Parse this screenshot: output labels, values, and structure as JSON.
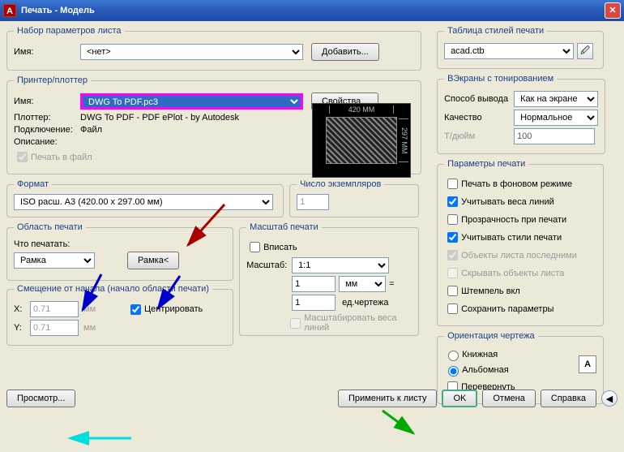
{
  "window": {
    "title": "Печать - Модель"
  },
  "pageset": {
    "legend": "Набор параметров листа",
    "name_lbl": "Имя:",
    "name_val": "<нет>",
    "add_btn": "Добавить..."
  },
  "printer": {
    "legend": "Принтер/плоттер",
    "name_lbl": "Имя:",
    "name_val": "DWG To PDF.pc3",
    "props_btn": "Свойства...",
    "plotter_lbl": "Плоттер:",
    "plotter_val": "DWG To PDF - PDF ePlot - by Autodesk",
    "conn_lbl": "Подключение:",
    "conn_val": "Файл",
    "desc_lbl": "Описание:",
    "tofile": "Печать в файл",
    "dim_w": "420 MM",
    "dim_h": "297 MM"
  },
  "format": {
    "legend": "Формат",
    "val": "ISO расш. A3 (420.00 x 297.00 мм)"
  },
  "copies": {
    "legend": "Число экземпляров",
    "val": "1"
  },
  "area": {
    "legend": "Область печати",
    "what_lbl": "Что печатать:",
    "what_val": "Рамка",
    "window_btn": "Рамка<"
  },
  "scale": {
    "legend": "Масштаб печати",
    "fit": "Вписать",
    "scale_lbl": "Масштаб:",
    "scale_val": "1:1",
    "val1": "1",
    "unit": "мм",
    "eq": "=",
    "val2": "1",
    "unit2": "ед.чертежа",
    "scale_lw": "Масштабировать веса линий"
  },
  "offset": {
    "legend": "Смещение от начала (начало области печати)",
    "x_lbl": "X:",
    "x_val": "0.71",
    "y_lbl": "Y:",
    "y_val": "0.71",
    "mm": "мм",
    "center": "Центрировать"
  },
  "styletable": {
    "legend": "Таблица стилей печати",
    "val": "acad.ctb"
  },
  "shade": {
    "legend": "ВЭкраны с тонированием",
    "mode_lbl": "Способ вывода",
    "mode_val": "Как на экране",
    "quality_lbl": "Качество",
    "quality_val": "Нормальное",
    "dpi_lbl": "Т/дюйм",
    "dpi_val": "100"
  },
  "params": {
    "legend": "Параметры печати",
    "bg": "Печать в фоновом режиме",
    "lw": "Учитывать веса линий",
    "trans": "Прозрачность при печати",
    "styles": "Учитывать стили печати",
    "last": "Объекты листа последними",
    "hide": "Скрывать объекты листа",
    "stamp": "Штемпель вкл",
    "save": "Сохранить параметры"
  },
  "orient": {
    "legend": "Ориентация чертежа",
    "portrait": "Книжная",
    "landscape": "Альбомная",
    "upside": "Перевернуть"
  },
  "footer": {
    "preview": "Просмотр...",
    "apply": "Применить к листу",
    "ok": "OK",
    "cancel": "Отмена",
    "help": "Справка"
  }
}
